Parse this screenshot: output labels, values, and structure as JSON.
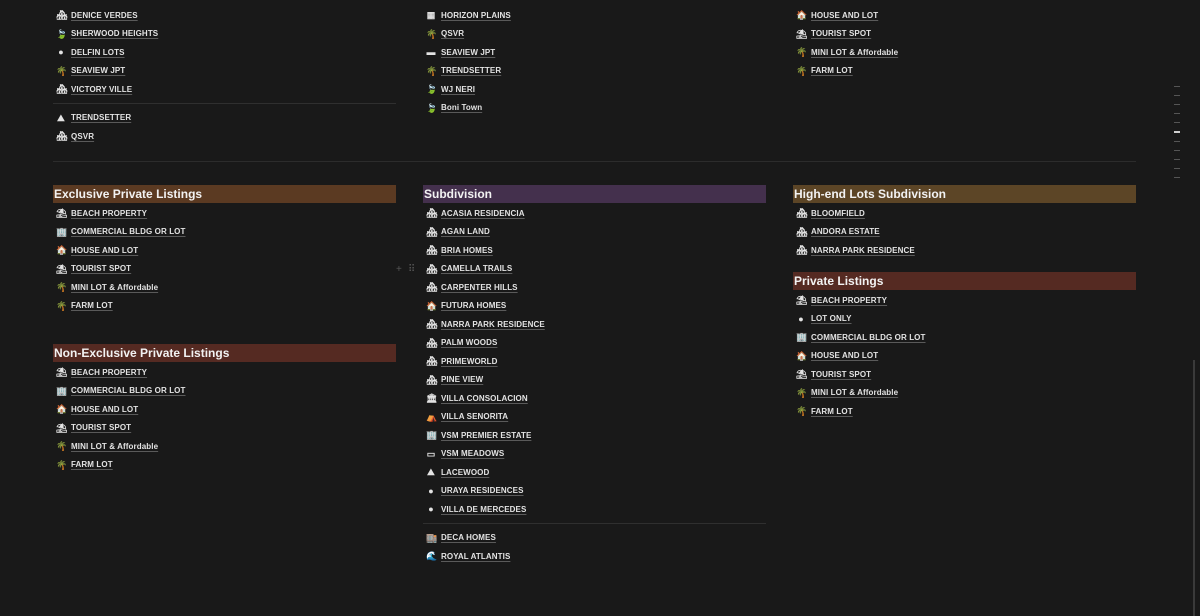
{
  "top": {
    "col1_items": [
      {
        "icon": "house-icon",
        "glyph": "🏘",
        "label": "DENICE VERDES"
      },
      {
        "icon": "leaf-icon",
        "glyph": "🍃",
        "label": "SHERWOOD HEIGHTS"
      },
      {
        "icon": "globe-icon",
        "glyph": "●",
        "label": "DELFIN LOTS"
      },
      {
        "icon": "palm-icon",
        "glyph": "🌴",
        "label": "SEAVIEW JPT"
      },
      {
        "icon": "house-icon",
        "glyph": "🏘",
        "label": "VICTORY VILLE"
      }
    ],
    "col1_items_after": [
      {
        "icon": "mountain-icon",
        "glyph": "⛰",
        "label": "TRENDSETTER"
      },
      {
        "icon": "house-icon",
        "glyph": "🏘",
        "label": "QSVR"
      }
    ],
    "col2_items": [
      {
        "icon": "landscape-icon",
        "glyph": "▦",
        "label": "HORIZON PLAINS"
      },
      {
        "icon": "palm-icon",
        "glyph": "🌴",
        "label": "QSVR"
      },
      {
        "icon": "sunset-icon",
        "glyph": "▬",
        "label": "SEAVIEW JPT"
      },
      {
        "icon": "palm-icon",
        "glyph": "🌴",
        "label": "TRENDSETTER"
      },
      {
        "icon": "leaf-icon",
        "glyph": "🍃",
        "label": "WJ NERI"
      },
      {
        "icon": "leaf-icon",
        "glyph": "🍃",
        "label": "Boni Town"
      }
    ],
    "col3_items": [
      {
        "icon": "house-icon",
        "glyph": "🏠",
        "label": "HOUSE AND LOT"
      },
      {
        "icon": "beach-icon",
        "glyph": "⛱",
        "label": "TOURIST SPOT"
      },
      {
        "icon": "palm-icon",
        "glyph": "🌴",
        "label": "MINI LOT & Affordable"
      },
      {
        "icon": "palm-icon",
        "glyph": "🌴",
        "label": "FARM LOT"
      }
    ]
  },
  "exclusive": {
    "title": "Exclusive Private Listings",
    "items": [
      {
        "icon": "umbrella-icon",
        "glyph": "⛱",
        "label": "BEACH PROPERTY"
      },
      {
        "icon": "office-icon",
        "glyph": "🏢",
        "label": "COMMERCIAL BLDG OR LOT"
      },
      {
        "icon": "house-icon",
        "glyph": "🏠",
        "label": "HOUSE AND LOT"
      },
      {
        "icon": "beach-icon",
        "glyph": "⛱",
        "label": "TOURIST SPOT"
      },
      {
        "icon": "palm-icon",
        "glyph": "🌴",
        "label": "MINI LOT & Affordable"
      },
      {
        "icon": "palm-icon",
        "glyph": "🌴",
        "label": "FARM LOT"
      }
    ]
  },
  "nonexclusive": {
    "title": "Non-Exclusive Private Listings",
    "items": [
      {
        "icon": "umbrella-icon",
        "glyph": "⛱",
        "label": "BEACH PROPERTY"
      },
      {
        "icon": "office-icon",
        "glyph": "🏢",
        "label": "COMMERCIAL BLDG OR LOT"
      },
      {
        "icon": "house-icon",
        "glyph": "🏠",
        "label": "HOUSE AND LOT"
      },
      {
        "icon": "beach-icon",
        "glyph": "⛱",
        "label": "TOURIST SPOT"
      },
      {
        "icon": "palm-icon",
        "glyph": "🌴",
        "label": "MINI LOT & Affordable"
      },
      {
        "icon": "palm-icon",
        "glyph": "🌴",
        "label": "FARM LOT"
      }
    ]
  },
  "subdivision": {
    "title": "Subdivision",
    "items": [
      {
        "icon": "house-icon",
        "glyph": "🏘",
        "label": "ACASIA RESIDENCIA"
      },
      {
        "icon": "house-icon",
        "glyph": "🏘",
        "label": "AGAN LAND"
      },
      {
        "icon": "house-icon",
        "glyph": "🏘",
        "label": "BRIA HOMES"
      },
      {
        "icon": "house-icon",
        "glyph": "🏘",
        "label": "CAMELLA TRAILS"
      },
      {
        "icon": "house-icon",
        "glyph": "🏘",
        "label": "CARPENTER HILLS"
      },
      {
        "icon": "house-icon",
        "glyph": "🏠",
        "label": "FUTURA HOMES"
      },
      {
        "icon": "house-icon",
        "glyph": "🏘",
        "label": "NARRA PARK RESIDENCE"
      },
      {
        "icon": "house-icon",
        "glyph": "🏘",
        "label": "PALM WOODS"
      },
      {
        "icon": "house-icon",
        "glyph": "🏘",
        "label": "PRIMEWORLD"
      },
      {
        "icon": "house-icon",
        "glyph": "🏘",
        "label": "PINE VIEW"
      },
      {
        "icon": "building-icon",
        "glyph": "🏛",
        "label": "VILLA CONSOLACION"
      },
      {
        "icon": "tent-icon",
        "glyph": "⛺",
        "label": "VILLA SENORITA"
      },
      {
        "icon": "office-icon",
        "glyph": "🏢",
        "label": "VSM PREMIER ESTATE"
      },
      {
        "icon": "book-icon",
        "glyph": "▭",
        "label": "VSM MEADOWS"
      },
      {
        "icon": "mountain-icon",
        "glyph": "⛰",
        "label": "LACEWOOD"
      },
      {
        "icon": "globe-icon",
        "glyph": "●",
        "label": "URAYA RESIDENCES"
      },
      {
        "icon": "globe-icon",
        "glyph": "●",
        "label": "VILLA DE MERCEDES"
      }
    ],
    "items_after": [
      {
        "icon": "office-icon",
        "glyph": "🏬",
        "label": "DECA HOMES"
      },
      {
        "icon": "wave-icon",
        "glyph": "🌊",
        "label": "ROYAL ATLANTIS"
      }
    ]
  },
  "highend": {
    "title": "High-end Lots Subdivision",
    "items": [
      {
        "icon": "house-icon",
        "glyph": "🏘",
        "label": "BLOOMFIELD"
      },
      {
        "icon": "house-icon",
        "glyph": "🏘",
        "label": "ANDORA ESTATE"
      },
      {
        "icon": "house-icon",
        "glyph": "🏘",
        "label": "NARRA PARK RESIDENCE"
      }
    ]
  },
  "private": {
    "title": "Private Listings",
    "items": [
      {
        "icon": "umbrella-icon",
        "glyph": "⛱",
        "label": "BEACH PROPERTY"
      },
      {
        "icon": "globe-icon",
        "glyph": "●",
        "label": "LOT ONLY"
      },
      {
        "icon": "office-icon",
        "glyph": "🏢",
        "label": "COMMERCIAL BLDG OR LOT"
      },
      {
        "icon": "house-icon",
        "glyph": "🏠",
        "label": "HOUSE AND LOT"
      },
      {
        "icon": "beach-icon",
        "glyph": "⛱",
        "label": "TOURIST SPOT"
      },
      {
        "icon": "palm-icon",
        "glyph": "🌴",
        "label": "MINI LOT & Affordable"
      },
      {
        "icon": "palm-icon",
        "glyph": "🌴",
        "label": "FARM LOT"
      }
    ]
  },
  "colors": {
    "bg": "#191919",
    "heading_orange": "#5b3a22",
    "heading_purple": "#44304d",
    "heading_gold": "#5c4526",
    "heading_red": "#552a22"
  }
}
